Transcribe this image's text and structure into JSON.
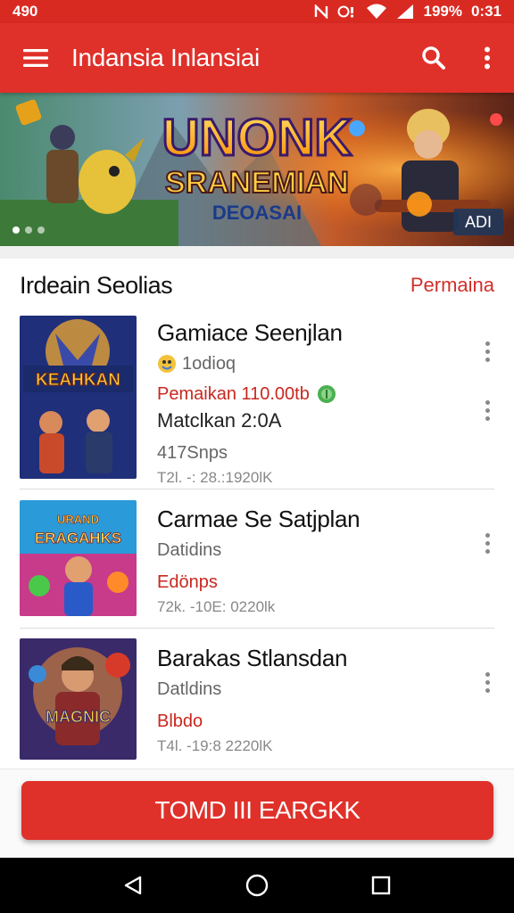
{
  "status_bar": {
    "left": "490",
    "battery": "199%",
    "time": "0:31"
  },
  "app_bar": {
    "title": "Indansia Inlansiai",
    "menu_icon": "hamburger-menu-icon",
    "search_icon": "search-icon",
    "more_icon": "more-vert-icon"
  },
  "banner": {
    "title_line1": "UNONK",
    "title_line2": "SRANEMIAN",
    "title_line3": "DEOASAI",
    "ad_label": "ADI",
    "dots": 3,
    "active_dot": 0
  },
  "section": {
    "title": "Irdeain Seolias",
    "link": "Permaina"
  },
  "games": [
    {
      "name": "Gamiace Seenjlan",
      "meta": "1odioq",
      "price": "Pemaikan 110.00tb",
      "detail": "Matclkan 2:0A",
      "sub": "417Snps",
      "stats": "T2l. -: 28.:1920lK",
      "thumb_text": "KEAHKAN"
    },
    {
      "name": "Carmae Se Satjplan",
      "meta": "Datidins",
      "price": "Edönps",
      "stats": "72k. -10E: 0220lk",
      "thumb_text": "ERAGAHKS"
    },
    {
      "name": "Barakas Stlansdan",
      "meta": "Datldins",
      "price": "Blbdo",
      "stats": "T4l. -19:8 2220lK",
      "thumb_text": "MAGNIC"
    }
  ],
  "cta": {
    "label": "TOMD III EARGKK"
  },
  "colors": {
    "brand_red": "#e0302a",
    "status_red": "#d92a22",
    "price_red": "#c8281f",
    "coin_green": "#4caf50"
  }
}
